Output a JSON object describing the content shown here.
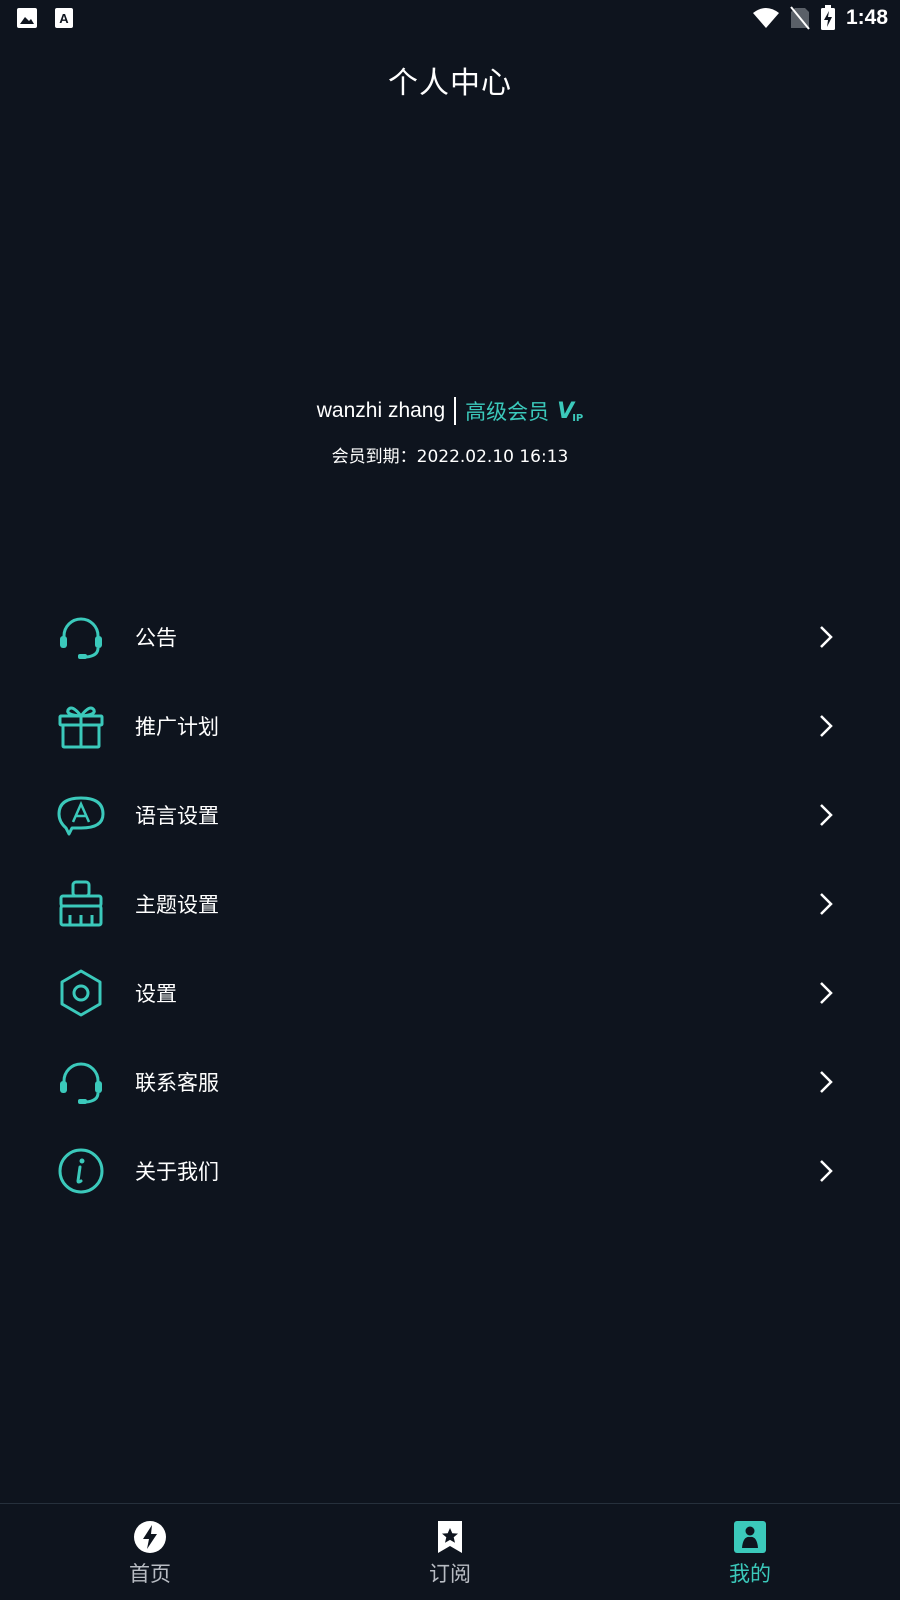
{
  "status_bar": {
    "time": "1:48",
    "left_icons": [
      "image-icon",
      "font-app-icon"
    ],
    "right_icons": [
      "wifi-icon",
      "no-sim-icon",
      "battery-charging-icon"
    ]
  },
  "header": {
    "title": "个人中心"
  },
  "profile": {
    "username": "wanzhi zhang",
    "member_level": "高级会员",
    "vip_badge": "V",
    "vip_badge_sub": "IP",
    "expiry": "会员到期：2022.02.10 16:13"
  },
  "menu": {
    "items": [
      {
        "label": "公告",
        "icon": "headset-icon"
      },
      {
        "label": "推广计划",
        "icon": "gift-icon"
      },
      {
        "label": "语言设置",
        "icon": "language-bubble-icon"
      },
      {
        "label": "主题设置",
        "icon": "brush-icon"
      },
      {
        "label": "设置",
        "icon": "hex-nut-icon"
      },
      {
        "label": "联系客服",
        "icon": "headset-icon"
      },
      {
        "label": "关于我们",
        "icon": "info-icon"
      }
    ]
  },
  "bottom_nav": {
    "tabs": [
      {
        "label": "首页",
        "icon": "lightning-icon",
        "active": false
      },
      {
        "label": "订阅",
        "icon": "bookmark-star-icon",
        "active": false
      },
      {
        "label": "我的",
        "icon": "person-icon",
        "active": true
      }
    ]
  },
  "colors": {
    "background": "#0e141e",
    "accent": "#3bc9bb",
    "text": "#ffffff",
    "inactive_tab": "#b8bcc3"
  }
}
